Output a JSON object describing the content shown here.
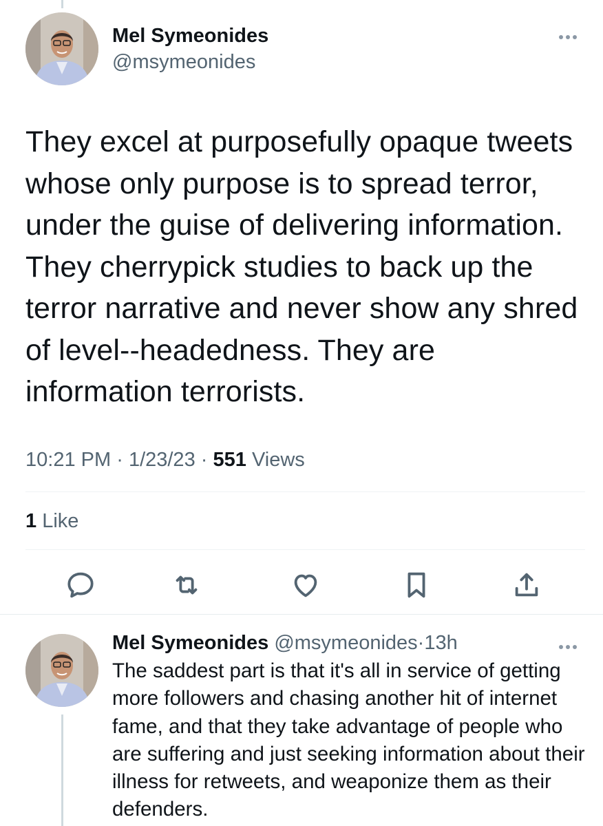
{
  "tweet": {
    "author": {
      "display_name": "Mel Symeonides",
      "handle": "@msymeonides"
    },
    "text": "They excel at purposefully opaque tweets whose only purpose is to spread terror, under the guise of delivering information. They cherrypick studies to back up the terror narrative and never show any shred of level--headedness. They are information terrorists.",
    "time": "10:21 PM",
    "date": "1/23/23",
    "separator": "·",
    "views_count": "551",
    "views_label": "Views",
    "likes_count": "1",
    "likes_label": "Like"
  },
  "actions": [
    {
      "name": "reply-icon"
    },
    {
      "name": "retweet-icon"
    },
    {
      "name": "like-icon"
    },
    {
      "name": "bookmark-icon"
    },
    {
      "name": "share-icon"
    }
  ],
  "reply": {
    "author": {
      "display_name": "Mel Symeonides",
      "handle": "@msymeonides"
    },
    "separator": "·",
    "time": "13h",
    "text": "The saddest part is that it's all in service of getting more followers and chasing another hit of internet fame, and that they take advantage of people who are suffering and just seeking information about their illness for retweets, and weaponize them as their defenders."
  },
  "colors": {
    "text": "#0f1419",
    "secondary": "#536471",
    "icon": "#536471",
    "divider": "#eff3f4",
    "thread_line": "#cfd9de"
  }
}
